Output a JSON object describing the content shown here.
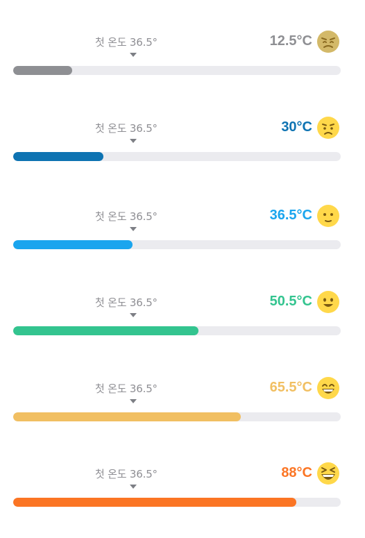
{
  "rows": [
    {
      "label": "첫 온도 36.5°",
      "temp": "12.5°C",
      "color": "#8e8f93",
      "fill_fraction": 0.18,
      "face_icon": "weary-face-icon",
      "face_color": "#f0c64a"
    },
    {
      "label": "첫 온도 36.5°",
      "temp": "30°C",
      "color": "#0e73b2",
      "fill_fraction": 0.275,
      "face_icon": "sad-face-icon",
      "face_color": "#ffd84a"
    },
    {
      "label": "첫 온도 36.5°",
      "temp": "36.5°C",
      "color": "#1aa5ee",
      "fill_fraction": 0.365,
      "face_icon": "neutral-face-icon",
      "face_color": "#ffd84a"
    },
    {
      "label": "첫 온도 36.5°",
      "temp": "50.5°C",
      "color": "#33c48f",
      "fill_fraction": 0.565,
      "face_icon": "smile-face-icon",
      "face_color": "#ffd84a"
    },
    {
      "label": "첫 온도 36.5°",
      "temp": "65.5°C",
      "color": "#f1bf62",
      "fill_fraction": 0.695,
      "face_icon": "grin-face-icon",
      "face_color": "#ffd84a"
    },
    {
      "label": "첫 온도 36.5°",
      "temp": "88°C",
      "color": "#fb7524",
      "fill_fraction": 0.865,
      "face_icon": "laughing-face-icon",
      "face_color": "#ffd84a"
    }
  ]
}
